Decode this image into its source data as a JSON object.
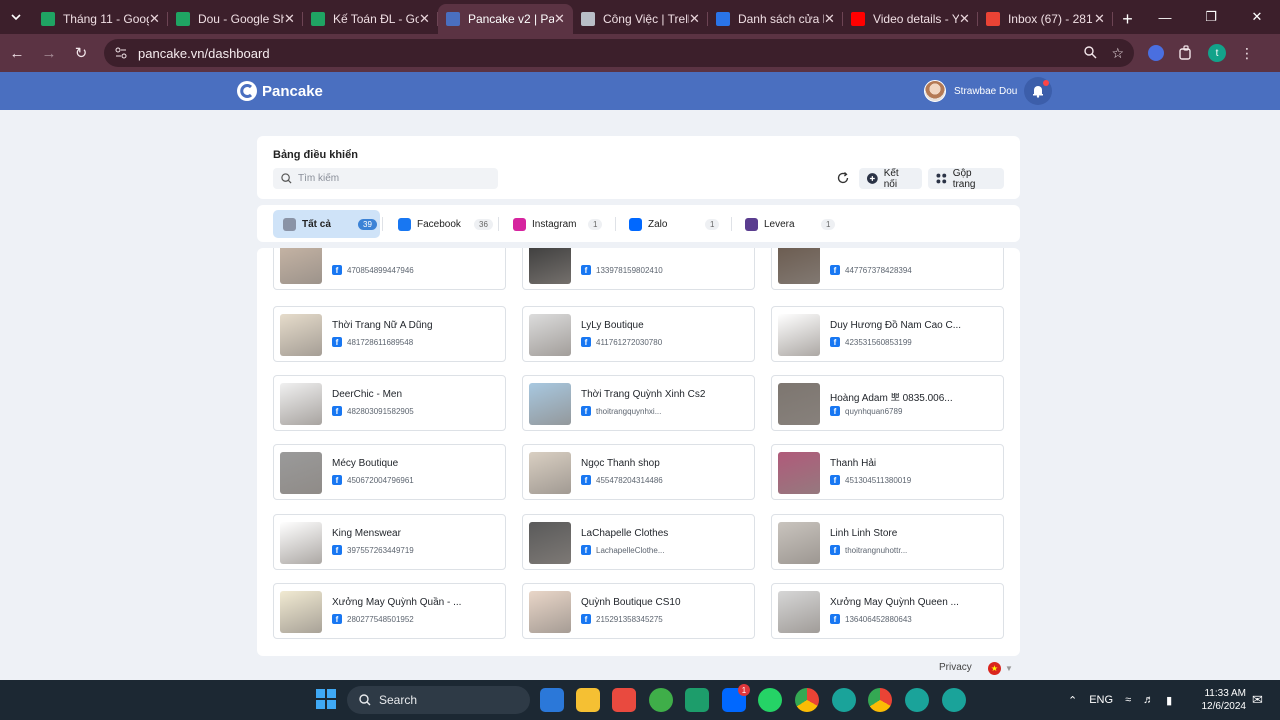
{
  "browser": {
    "tabs": [
      {
        "title": "Tháng 11 - Goog",
        "color": "#1fa463",
        "active": false
      },
      {
        "title": "Dou - Google Sh",
        "color": "#1fa463",
        "active": false
      },
      {
        "title": "Kế Toán ĐL - Go",
        "color": "#1fa463",
        "active": false
      },
      {
        "title": "Pancake v2 | Pan",
        "color": "#4a6fc0",
        "active": true
      },
      {
        "title": "Công Việc | Trello",
        "color": "#b9bec7",
        "active": false
      },
      {
        "title": "Danh sách cửa h",
        "color": "#2a74e8",
        "active": false
      },
      {
        "title": "Video details - Y",
        "color": "#ff0000",
        "active": false
      },
      {
        "title": "Inbox (67) - 281",
        "color": "#ea4335",
        "active": false
      }
    ],
    "close_glyph": "✕",
    "new_tab_glyph": "+",
    "url": "pancake.vn/dashboard",
    "profile_initial": "t"
  },
  "app": {
    "brand": "Pancake",
    "user_name": "Strawbae Dou",
    "page_title": "Bảng điều khiển",
    "search_placeholder": "Tìm kiếm",
    "connect_label": "Kết nối",
    "merge_label": "Gộp trang",
    "channels": [
      {
        "label": "Tất cả",
        "count": "39",
        "icon": "all-pages-icon",
        "color": "#8a93a6"
      },
      {
        "label": "Facebook",
        "count": "36",
        "icon": "facebook-icon",
        "color": "#1877f2"
      },
      {
        "label": "Instagram",
        "count": "1",
        "icon": "instagram-icon",
        "color": "#d6249f"
      },
      {
        "label": "Zalo",
        "count": "1",
        "icon": "zalo-icon",
        "color": "#0068ff"
      },
      {
        "label": "Levera",
        "count": "1",
        "icon": "levera-icon",
        "color": "#5a3d8f"
      }
    ],
    "pages": [
      {
        "name": "",
        "id": "470854899447946",
        "thumb": "#c8b6a6"
      },
      {
        "name": "",
        "id": "133978159802410",
        "thumb": "#3b3b3b"
      },
      {
        "name": "",
        "id": "447767378428394",
        "thumb": "#6a5a4e"
      },
      {
        "name": "Thời Trang Nữ A Dũng",
        "id": "481728611689548",
        "thumb": "#e6dccb"
      },
      {
        "name": "LyLy Boutique",
        "id": "411761272030780",
        "thumb": "#dcdcdc"
      },
      {
        "name": "Duy Hương Đồ Nam Cao C...",
        "id": "423531560853199",
        "thumb": "#ffffff"
      },
      {
        "name": "DeerChic - Men",
        "id": "482803091582905",
        "thumb": "#f0f0f0"
      },
      {
        "name": "Thời Trang Quỳnh Xinh Cs2",
        "id": "thoitrangquynhxi...",
        "thumb": "#a8c8e0"
      },
      {
        "name": "Hoàng Adam 뽀 0835.006...",
        "id": "quynhquan6789",
        "thumb": "#7d7670"
      },
      {
        "name": "Mécy Boutique",
        "id": "450672004796961",
        "thumb": "#9a9a9a"
      },
      {
        "name": "Ngọc Thanh shop",
        "id": "455478204314486",
        "thumb": "#d9cfc2"
      },
      {
        "name": "Thanh Hải",
        "id": "451304511380019",
        "thumb": "#b05a7a"
      },
      {
        "name": "King Menswear",
        "id": "397557263449719",
        "thumb": "#ffffff"
      },
      {
        "name": "LaChapelle Clothes",
        "id": "LachapelleClothe...",
        "thumb": "#5a5a5a"
      },
      {
        "name": "Linh Linh Store",
        "id": "thoitrangnuhottr...",
        "thumb": "#c9c4be"
      },
      {
        "name": "Xưởng May Quỳnh Quần - ...",
        "id": "280277548501952",
        "thumb": "#f1ead2"
      },
      {
        "name": "Quỳnh Boutique CS10",
        "id": "215291358345275",
        "thumb": "#e9d6c8"
      },
      {
        "name": "Xưởng May Quỳnh Queen ...",
        "id": "136406452880643",
        "thumb": "#d6d6d6"
      }
    ],
    "footer_privacy": "Privacy"
  },
  "taskbar": {
    "search_label": "Search",
    "lang": "ENG",
    "time": "11:33 AM",
    "date": "12/6/2024",
    "badge": "1"
  }
}
